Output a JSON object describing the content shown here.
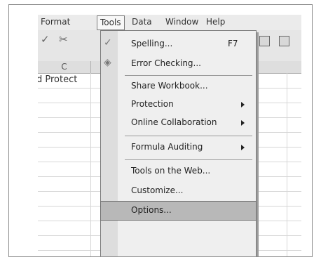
{
  "menubar": {
    "items": [
      "Format",
      "Tools",
      "Data",
      "Window",
      "Help"
    ]
  },
  "sheet": {
    "column_label": "C",
    "cell_text": "d Protect"
  },
  "tools_menu": {
    "items": [
      {
        "label": "Spelling...",
        "shortcut": "F7",
        "icon": "spelling-icon"
      },
      {
        "label": "Error Checking...",
        "icon": "error-checking-icon"
      },
      {
        "label": "Share Workbook..."
      },
      {
        "label": "Protection",
        "submenu": true
      },
      {
        "label": "Online Collaboration",
        "submenu": true
      },
      {
        "label": "Formula Auditing",
        "submenu": true
      },
      {
        "label": "Tools on the Web..."
      },
      {
        "label": "Customize..."
      },
      {
        "label": "Options...",
        "highlighted": true
      }
    ]
  },
  "colors": {
    "highlight": "#b8b8b8",
    "menu_bg": "#efefef"
  }
}
